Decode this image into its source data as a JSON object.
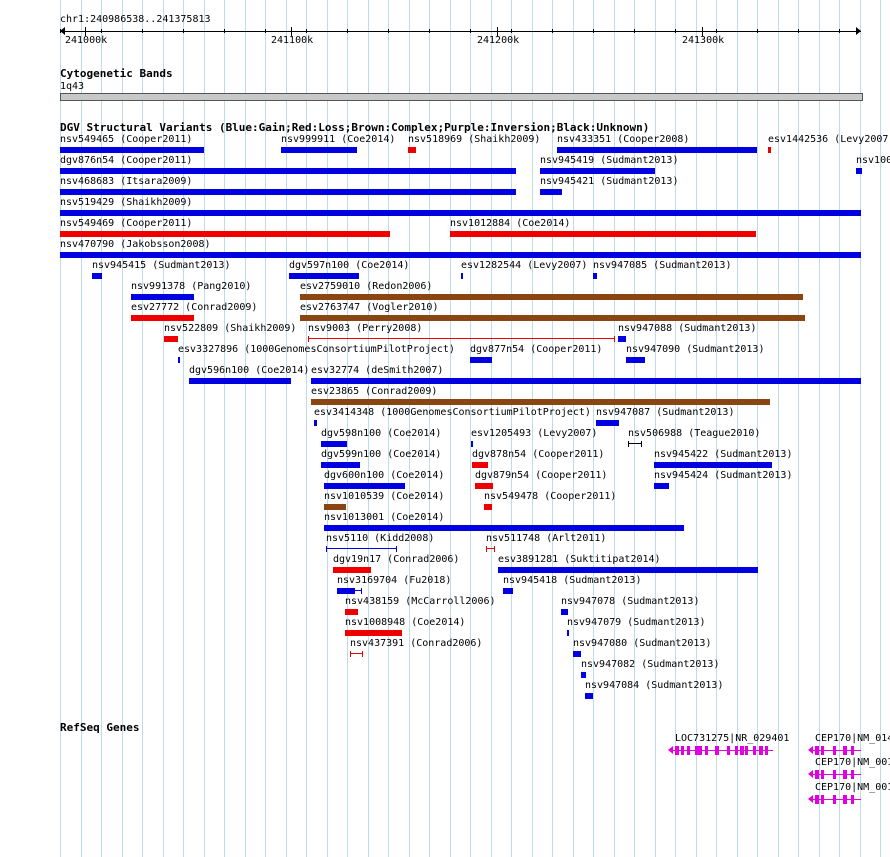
{
  "ruler": {
    "range_label": "chr1:240986538..241375813",
    "ticks": [
      "241000k",
      "241100k",
      "241200k",
      "241300k"
    ]
  },
  "tracks": {
    "cytoband": {
      "title": "Cytogenetic Bands",
      "band": "1q43"
    },
    "dgv": {
      "title": "DGV Structural Variants (Blue:Gain;Red:Loss;Brown:Complex;Purple:Inversion;Black:Unknown)"
    },
    "refseq": {
      "title": "RefSeq Genes"
    }
  },
  "colors": {
    "gain": "#0000e0",
    "loss": "#ee0000",
    "complex": "#8b4513",
    "unknown": "#000000",
    "gene": "#e000e0",
    "grid": "#bcdcec",
    "cytoband_fill": "#c8c8c8"
  },
  "variants": [
    {
      "label": "nsv549465 (Cooper2011)",
      "type": "gain"
    },
    {
      "label": "nsv999911 (Coe2014)",
      "type": "gain"
    },
    {
      "label": "nsv518969 (Shaikh2009)",
      "type": "loss"
    },
    {
      "label": "nsv433351 (Cooper2008)",
      "type": "gain"
    },
    {
      "label": "esv1442536 (Levy2007)",
      "type": "loss"
    },
    {
      "label": "dgv876n54 (Cooper2011)",
      "type": "gain"
    },
    {
      "label": "nsv945419 (Sudmant2013)",
      "type": "gain"
    },
    {
      "label": "nsv100",
      "type": "gain"
    },
    {
      "label": "nsv468683 (Itsara2009)",
      "type": "gain"
    },
    {
      "label": "nsv945421 (Sudmant2013)",
      "type": "gain"
    },
    {
      "label": "nsv519429 (Shaikh2009)",
      "type": "gain"
    },
    {
      "label": "nsv549469 (Cooper2011)",
      "type": "loss"
    },
    {
      "label": "nsv1012884 (Coe2014)",
      "type": "loss"
    },
    {
      "label": "nsv470790 (Jakobsson2008)",
      "type": "gain"
    },
    {
      "label": "nsv945415 (Sudmant2013)",
      "type": "gain"
    },
    {
      "label": "dgv597n100 (Coe2014)",
      "type": "gain"
    },
    {
      "label": "esv1282544 (Levy2007)",
      "type": "gain"
    },
    {
      "label": "nsv947085 (Sudmant2013)",
      "type": "gain"
    },
    {
      "label": "nsv991378 (Pang2010)",
      "type": "gain"
    },
    {
      "label": "esv2759010 (Redon2006)",
      "type": "complex"
    },
    {
      "label": "esv27772 (Conrad2009)",
      "type": "loss"
    },
    {
      "label": "esv2763747 (Vogler2010)",
      "type": "complex"
    },
    {
      "label": "nsv522809 (Shaikh2009)",
      "type": "loss"
    },
    {
      "label": "nsv9003 (Perry2008)",
      "type": "loss"
    },
    {
      "label": "nsv947088 (Sudmant2013)",
      "type": "gain"
    },
    {
      "label": "esv3327896 (1000GenomesConsortiumPilotProject)",
      "type": "gain"
    },
    {
      "label": "dgv877n54 (Cooper2011)",
      "type": "gain"
    },
    {
      "label": "nsv947090 (Sudmant2013)",
      "type": "gain"
    },
    {
      "label": "dgv596n100 (Coe2014)",
      "type": "gain"
    },
    {
      "label": "esv32774 (deSmith2007)",
      "type": "gain"
    },
    {
      "label": "esv23865 (Conrad2009)",
      "type": "complex"
    },
    {
      "label": "esv3414348 (1000GenomesConsortiumPilotProject)",
      "type": "gain"
    },
    {
      "label": "nsv947087 (Sudmant2013)",
      "type": "gain"
    },
    {
      "label": "dgv598n100 (Coe2014)",
      "type": "gain"
    },
    {
      "label": "esv1205493 (Levy2007)",
      "type": "gain"
    },
    {
      "label": "nsv506988 (Teague2010)",
      "type": "unknown"
    },
    {
      "label": "dgv599n100 (Coe2014)",
      "type": "gain"
    },
    {
      "label": "dgv878n54 (Cooper2011)",
      "type": "loss"
    },
    {
      "label": "nsv945422 (Sudmant2013)",
      "type": "gain"
    },
    {
      "label": "dgv600n100 (Coe2014)",
      "type": "gain"
    },
    {
      "label": "dgv879n54 (Cooper2011)",
      "type": "loss"
    },
    {
      "label": "nsv945424 (Sudmant2013)",
      "type": "gain"
    },
    {
      "label": "nsv1010539 (Coe2014)",
      "type": "complex"
    },
    {
      "label": "nsv549478 (Cooper2011)",
      "type": "loss"
    },
    {
      "label": "nsv1013001 (Coe2014)",
      "type": "gain"
    },
    {
      "label": "nsv5110 (Kidd2008)",
      "type": "gain"
    },
    {
      "label": "nsv511748 (Arlt2011)",
      "type": "loss"
    },
    {
      "label": "dgv19n17 (Conrad2006)",
      "type": "loss"
    },
    {
      "label": "esv3891281 (Suktitipat2014)",
      "type": "gain"
    },
    {
      "label": "nsv3169704 (Fu2018)",
      "type": "gain"
    },
    {
      "label": "nsv945418 (Sudmant2013)",
      "type": "gain"
    },
    {
      "label": "nsv438159 (McCarroll2006)",
      "type": "loss"
    },
    {
      "label": "nsv947078 (Sudmant2013)",
      "type": "gain"
    },
    {
      "label": "nsv1008948 (Coe2014)",
      "type": "loss"
    },
    {
      "label": "nsv947079 (Sudmant2013)",
      "type": "gain"
    },
    {
      "label": "nsv437391 (Conrad2006)",
      "type": "loss"
    },
    {
      "label": "nsv947080 (Sudmant2013)",
      "type": "gain"
    },
    {
      "label": "nsv947082 (Sudmant2013)",
      "type": "gain"
    },
    {
      "label": "nsv947084 (Sudmant2013)",
      "type": "gain"
    }
  ],
  "genes": [
    {
      "label": "LOC731275|NR_029401"
    },
    {
      "label": "CEP170|NM_014"
    },
    {
      "label": "CEP170|NM_001"
    },
    {
      "label": "CEP170|NM_001"
    }
  ]
}
